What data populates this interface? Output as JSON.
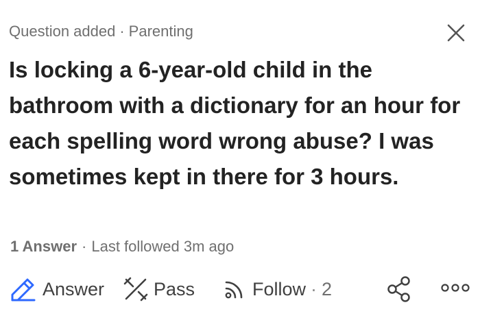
{
  "header": {
    "event": "Question added",
    "separator": "·",
    "topic": "Parenting"
  },
  "question": {
    "text": "Is locking a 6-year-old child in the bathroom with a dictionary for an hour for each spelling word wrong abuse? I was sometimes kept in there for 3 hours."
  },
  "stats": {
    "answers": "1 Answer",
    "separator": "·",
    "last_followed": "Last followed 3m ago"
  },
  "actions": {
    "answer_label": "Answer",
    "pass_label": "Pass",
    "follow_label": "Follow",
    "follow_separator": "·",
    "follow_count": "2"
  },
  "icons": {
    "close": "close-icon",
    "answer": "pencil-icon",
    "pass": "x-icon",
    "follow": "rss-icon",
    "share": "share-icon",
    "more": "more-icon"
  },
  "colors": {
    "accent": "#2e69ff",
    "text": "#232323",
    "muted": "#6f6f6f"
  }
}
